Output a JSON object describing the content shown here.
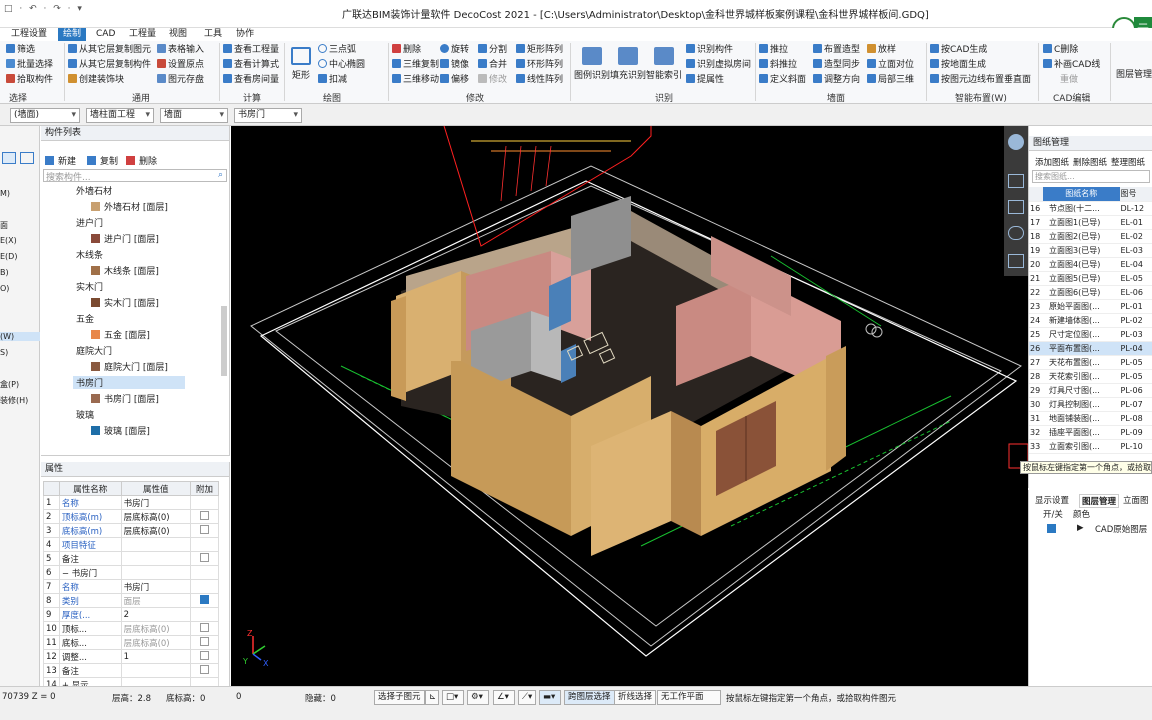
{
  "window": {
    "title": "广联达BIM装饰计量软件 DecoCost 2021 - [C:\\Users\\Administrator\\Desktop\\金科世界城样板案例课程\\金科世界城样板间.GDQ]",
    "quick_access": "□ · ↶ · ↷ · ▾"
  },
  "menu": [
    "工程设置",
    "绘制",
    "CAD",
    "工程量",
    "视图",
    "工具",
    "协作"
  ],
  "ribbon": {
    "select_items": [
      "筛选",
      "批量选择",
      "拾取构件"
    ],
    "select_group": "选择",
    "general_items": [
      "从其它层复制图元",
      "从其它层复制构件",
      "创建装饰块",
      "表格输入",
      "设置原点",
      "图元存盘"
    ],
    "general_group": "通用",
    "calc_items": [
      "查看工程量",
      "查看计算式",
      "查看房间量"
    ],
    "calc_group": "计算",
    "draw_big": "矩形",
    "draw_items": [
      "三点弧",
      "中心椭圆",
      "扣减"
    ],
    "draw_group": "绘图",
    "modify_items": [
      "删除",
      "三维复制",
      "三维移动",
      "旋转",
      "镜像",
      "偏移",
      "分割",
      "合并",
      "修改",
      "矩形阵列",
      "环形阵列",
      "线性阵列"
    ],
    "modify_group": "修改",
    "recog_big": [
      "图例识别",
      "填充识别",
      "智能索引"
    ],
    "recog_items": [
      "识别构件",
      "识别虚拟房间",
      "提属性"
    ],
    "recog_group": "识别",
    "wall_items": [
      "推拉",
      "斜推拉",
      "定义斜面",
      "布置造型",
      "造型同步",
      "调整方向",
      "放样",
      "立面对位",
      "局部三维"
    ],
    "wall_group": "墙面",
    "smart_items": [
      "按CAD生成",
      "按地面生成",
      "按图元边线布置垂直面"
    ],
    "smart_group": "智能布置(W)",
    "cad_items": [
      "C删除",
      "补画CAD线",
      "重做"
    ],
    "cad_group": "CAD编辑",
    "layer_mgmt": "图层管理"
  },
  "selectors": [
    "(墙面)",
    "墙柱面工程",
    "墙面",
    "书房门"
  ],
  "left_strip": [
    "M)",
    "面",
    "E(X)",
    "E(D)",
    "B)",
    "O)",
    "(W)",
    "S)",
    "盒(P)",
    "装修(H)"
  ],
  "component_list": {
    "header": "构件列表",
    "toolbar": [
      "新建",
      "复制",
      "删除"
    ],
    "search_placeholder": "搜索构件...",
    "groups": [
      {
        "name": "外墙石材",
        "item": "外墙石材 [面层]",
        "color": "#c8a070"
      },
      {
        "name": "进户门",
        "item": "进户门 [面层]",
        "color": "#8a4a3a"
      },
      {
        "name": "木线条",
        "item": "木线条 [面层]",
        "color": "#a07048"
      },
      {
        "name": "实木门",
        "item": "实木门 [面层]",
        "color": "#7a4a30"
      },
      {
        "name": "五金",
        "item": "五金 [面层]",
        "color": "#e8874a"
      },
      {
        "name": "庭院大门",
        "item": "庭院大门 [面层]",
        "color": "#8a5a40"
      },
      {
        "name": "书房门",
        "item": "书房门 [面层]",
        "color": "#9a6a50"
      },
      {
        "name": "玻璃",
        "item": "玻璃 [面层]",
        "color": "#1e6ea8"
      }
    ]
  },
  "properties": {
    "header": "属性",
    "columns": [
      "属性名称",
      "属性值",
      "附加"
    ],
    "rows": [
      {
        "n": "1",
        "name": "名称",
        "val": "书房门",
        "chk": ""
      },
      {
        "n": "2",
        "name": "顶标高(m)",
        "val": "层底标高(0)",
        "chk": "off"
      },
      {
        "n": "3",
        "name": "底标高(m)",
        "val": "层底标高(0)",
        "chk": "off"
      },
      {
        "n": "4",
        "name": "项目特征",
        "val": "",
        "chk": ""
      },
      {
        "n": "5",
        "name": "备注",
        "val": "",
        "chk": "off"
      },
      {
        "n": "6",
        "name": "− 书房门",
        "val": "",
        "chk": ""
      },
      {
        "n": "7",
        "name": "名称",
        "val": "书房门",
        "chk": ""
      },
      {
        "n": "8",
        "name": "类别",
        "val": "面层",
        "chk": "on"
      },
      {
        "n": "9",
        "name": "厚度(...",
        "val": "2",
        "chk": ""
      },
      {
        "n": "10",
        "name": "顶标...",
        "val": "层底标高(0)",
        "chk": "off"
      },
      {
        "n": "11",
        "name": "底标...",
        "val": "层底标高(0)",
        "chk": "off"
      },
      {
        "n": "12",
        "name": "调整...",
        "val": "1",
        "chk": "off"
      },
      {
        "n": "13",
        "name": "备注",
        "val": "",
        "chk": "off"
      },
      {
        "n": "14",
        "name": "+ 显示...",
        "val": "",
        "chk": ""
      }
    ]
  },
  "drawings": {
    "header": "图纸管理",
    "toolbar": [
      "添加图纸",
      "删除图纸",
      "整理图纸"
    ],
    "search_placeholder": "搜索图纸...",
    "columns": [
      "图纸名称",
      "图号"
    ],
    "rows": [
      {
        "n": "16",
        "name": "节点图(十二...",
        "code": "DL-12"
      },
      {
        "n": "17",
        "name": "立面图1(已导)",
        "code": "EL-01"
      },
      {
        "n": "18",
        "name": "立面图2(已导)",
        "code": "EL-02"
      },
      {
        "n": "19",
        "name": "立面图3(已导)",
        "code": "EL-03"
      },
      {
        "n": "20",
        "name": "立面图4(已导)",
        "code": "EL-04"
      },
      {
        "n": "21",
        "name": "立面图5(已导)",
        "code": "EL-05"
      },
      {
        "n": "22",
        "name": "立面图6(已导)",
        "code": "EL-06"
      },
      {
        "n": "23",
        "name": "原始平面图(...",
        "code": "PL-01"
      },
      {
        "n": "24",
        "name": "新建墙体图(...",
        "code": "PL-02"
      },
      {
        "n": "25",
        "name": "尺寸定位图(...",
        "code": "PL-03"
      },
      {
        "n": "26",
        "name": "平面布置图(...",
        "code": "PL-04"
      },
      {
        "n": "27",
        "name": "天花布置图(...",
        "code": "PL-05"
      },
      {
        "n": "28",
        "name": "天花索引图(...",
        "code": "PL-05"
      },
      {
        "n": "29",
        "name": "灯具尺寸图(...",
        "code": "PL-06"
      },
      {
        "n": "30",
        "name": "灯具控制图(...",
        "code": "PL-07"
      },
      {
        "n": "31",
        "name": "地面铺装图(...",
        "code": "PL-08"
      },
      {
        "n": "32",
        "name": "插座平面图(...",
        "code": "PL-09"
      },
      {
        "n": "33",
        "name": "立面索引图(...",
        "code": "PL-10"
      }
    ],
    "selected_row": "26"
  },
  "tooltip": "按鼠标左键指定第一个角点，或拾取",
  "layers": {
    "tabs": [
      "显示设置",
      "图层管理",
      "立面图"
    ],
    "columns": [
      "开/关",
      "颜色"
    ],
    "row": "CAD原始图层"
  },
  "status": {
    "coords": "70739 Z = 0",
    "floor_height": "层高：2.8",
    "base_elev": "底标高：0",
    "zero": "0",
    "hidden": "隐藏：0",
    "btn_select_sub": "选择子图元",
    "btn_cross_layer": "跨图层选择",
    "btn_polyline": "折线选择",
    "work_plane": "无工作平面",
    "hint": "按鼠标左键指定第一个角点，或拾取构件图元"
  },
  "logo": "云"
}
